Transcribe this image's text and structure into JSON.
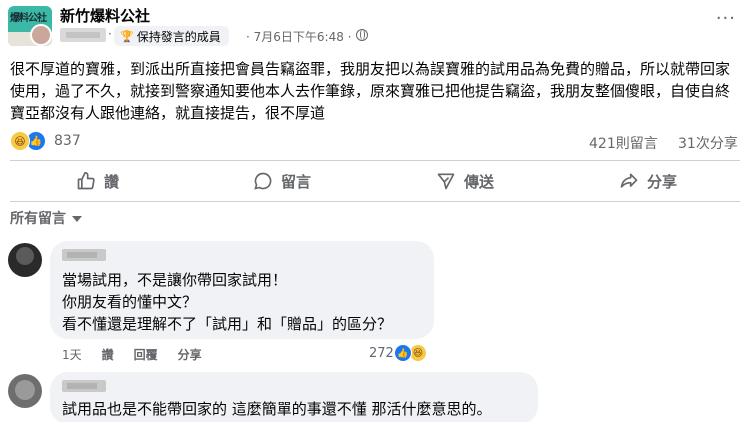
{
  "post": {
    "group_name": "新竹爆料公社",
    "avatar_logo_text": "爆料公社",
    "author_separator": "·",
    "badge_label": "保持發言的成員",
    "time": "· 7月6日下午6:48 ·",
    "more_label": "···",
    "body": "很不厚道的寶雅，到派出所直接把會員告竊盜罪，我朋友把以為誤寶雅的試用品為免費的贈品，所以就帶回家使用，過了不久，就接到警察通知要他本人去作筆錄，原來寶雅已把他提告竊盜，我朋友整個傻眼，自使自終寶亞都沒有人跟他連絡，就直接提告，很不厚道"
  },
  "stats": {
    "reaction_icons": [
      "haha-icon",
      "like-icon"
    ],
    "reaction_count": "837",
    "comments": "421則留言",
    "shares": "31次分享"
  },
  "actions": {
    "like": "讚",
    "comment": "留言",
    "send": "傳送",
    "share": "分享"
  },
  "comments_filter": {
    "label": "所有留言"
  },
  "comments": [
    {
      "lines": [
        "當場試用，不是讓你帶回家試用！",
        "你朋友看的懂中文？",
        "看不懂還是理解不了「試用」和「贈品」的區分？"
      ],
      "time": "1天",
      "like_label": "讚",
      "reply_label": "回覆",
      "share_label": "分享",
      "reaction_count": "272",
      "reaction_icons": [
        "like-icon",
        "haha-icon"
      ]
    },
    {
      "lines": [
        "試用品也是不能帶回家的 這麼簡單的事還不懂 那活什麼意思的。"
      ]
    }
  ],
  "colors": {
    "text_primary": "#050505",
    "text_secondary": "#65676b",
    "bubble_bg": "#f0f2f5",
    "like_blue": "#1877f2",
    "haha_yellow": "#f7c948",
    "divider": "#ced0d4"
  }
}
